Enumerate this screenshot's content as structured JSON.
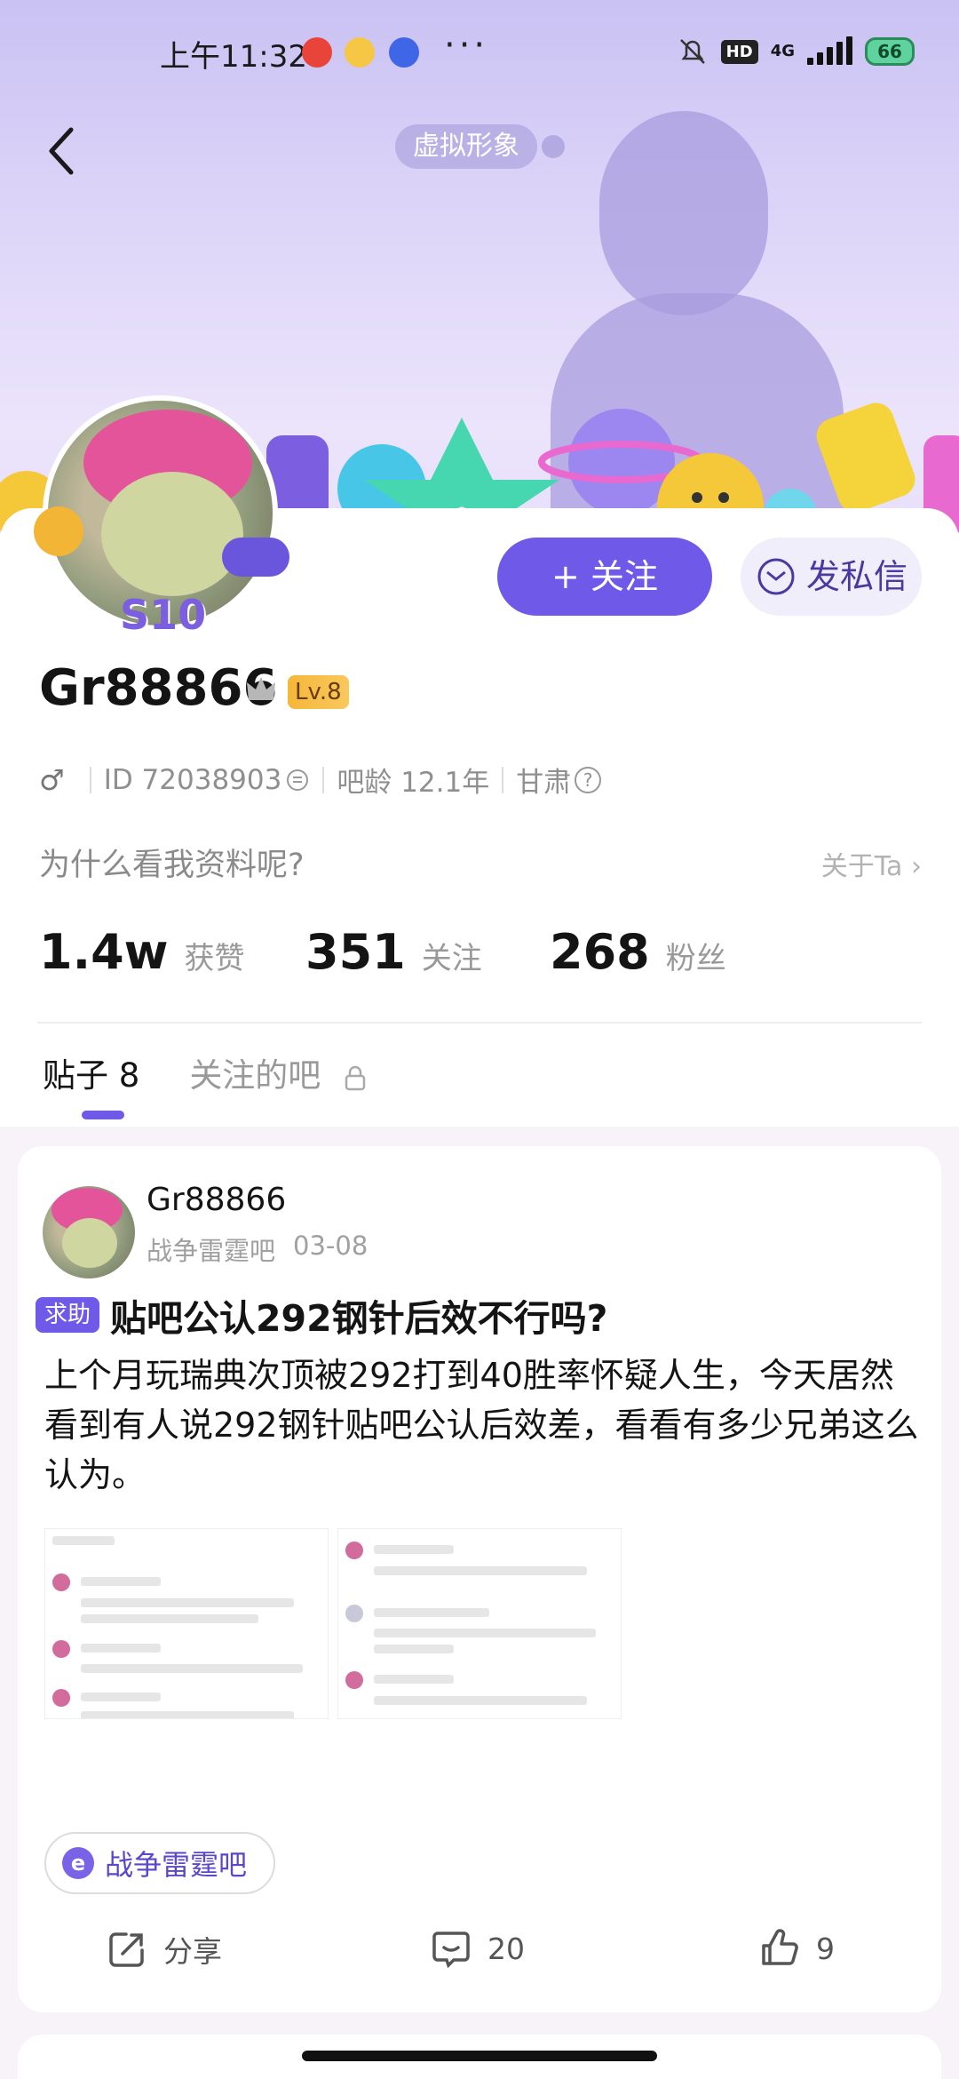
{
  "status_bar": {
    "time": "上午11:32",
    "network": "4G",
    "hd": "HD",
    "battery": "66"
  },
  "header": {
    "avatar_tag": "虚拟形象"
  },
  "profile": {
    "avatar_badge": "S10",
    "follow_label": "+ 关注",
    "dm_label": "发私信",
    "username": "Gr88866",
    "level": "Lv.8",
    "gender_icon": "♂",
    "id_text": "ID 72038903",
    "bar_age": "吧龄 12.1年",
    "region": "甘肃",
    "why_text": "为什么看我资料呢?",
    "about_label": "关于Ta"
  },
  "stats": [
    {
      "num": "1.4w",
      "label": "获赞"
    },
    {
      "num": "351",
      "label": "关注"
    },
    {
      "num": "268",
      "label": "粉丝"
    }
  ],
  "tabs": [
    {
      "label": "贴子 8",
      "active": true
    },
    {
      "label": "关注的吧",
      "active": false
    }
  ],
  "post": {
    "author": "Gr88866",
    "forum": "战争雷霆吧",
    "date": "03-08",
    "tag": "求助",
    "title": "贴吧公认292钢针后效不行吗?",
    "body": "上个月玩瑞典次顶被292打到40胜率怀疑人生，今天居然看到有人说292钢针贴吧公认后效差，看看有多少兄弟这么认为。",
    "forum_chip": "战争雷霆吧",
    "share_label": "分享",
    "comment_count": "20",
    "like_count": "9"
  },
  "colors": {
    "accent": "#6f59e8",
    "hero_top": "#c9c2f3"
  }
}
